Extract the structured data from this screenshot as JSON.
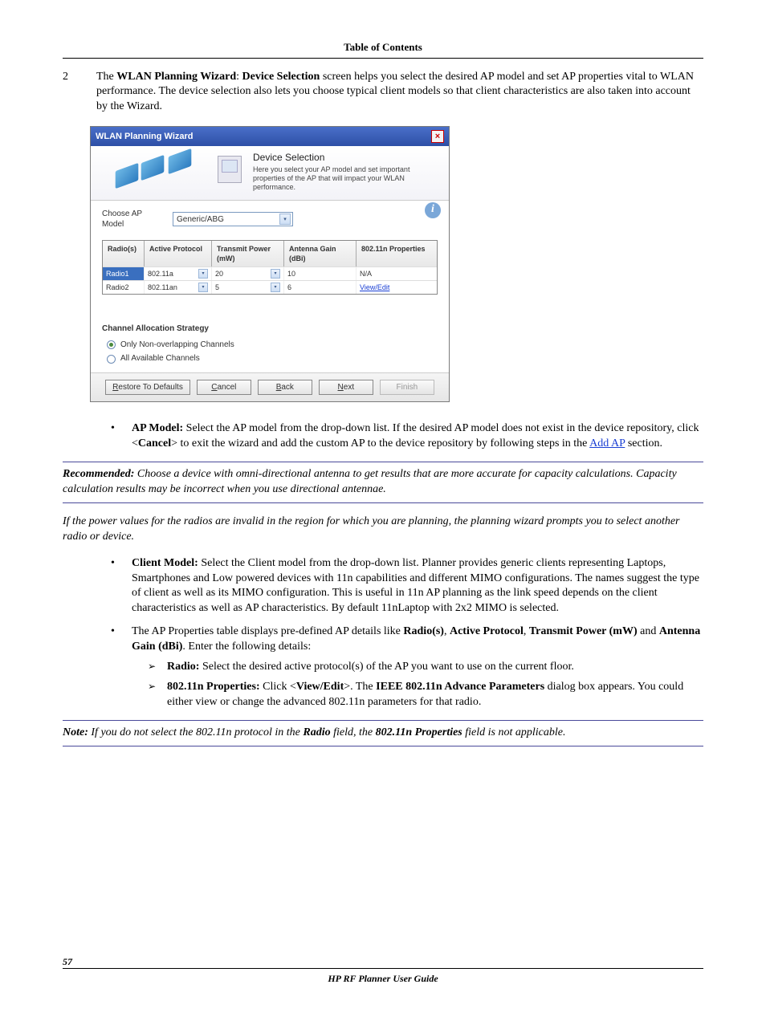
{
  "header": {
    "toc": "Table of Contents"
  },
  "step": {
    "num": "2",
    "text_pre": "The ",
    "b1": "WLAN Planning Wizard",
    "b2": "Device Selection",
    "text_post": " screen helps you select the desired AP model and set AP properties vital to WLAN performance. The device selection also lets you choose typical client models so that client characteristics are also taken into account by the Wizard."
  },
  "wizard": {
    "title": "WLAN Planning Wizard",
    "banner_title": "Device Selection",
    "banner_sub": "Here you select your AP model and set important properties of the AP that will impact your WLAN performance.",
    "ap_label": "Choose AP Model",
    "ap_value": "Generic/ABG",
    "cols": {
      "c1": "Radio(s)",
      "c2": "Active Protocol",
      "c3": "Transmit Power (mW)",
      "c4": "Antenna Gain (dBi)",
      "c5": "802.11n Properties"
    },
    "rows": [
      {
        "radio": "Radio1",
        "proto": "802.11a",
        "power": "20",
        "gain": "10",
        "prop": "N/A",
        "link": false,
        "selected": true
      },
      {
        "radio": "Radio2",
        "proto": "802.11an",
        "power": "5",
        "gain": "6",
        "prop": "View/Edit",
        "link": true,
        "selected": false
      }
    ],
    "strategy_label": "Channel Allocation Strategy",
    "opt1": "Only Non-overlapping Channels",
    "opt2": "All Available Channels",
    "buttons": {
      "restore": "Restore To Defaults",
      "cancel": "Cancel",
      "back": "Back",
      "next": "Next",
      "finish": "Finish"
    }
  },
  "bullets": {
    "ap_b": "AP Model:",
    "ap_t1": " Select the AP model from the drop-down list. If the desired AP model does not exist in the device repository, click <",
    "ap_cancel": "Cancel",
    "ap_t2": "> to exit the wizard and add the custom AP to the device repository by following steps in the ",
    "ap_link": "Add AP",
    "ap_t3": " section.",
    "rec_b": "Recommended:",
    "rec_t": " Choose a device with omni-directional antenna to get results that are more accurate for capacity calculations. Capacity calculation results may be incorrect when you use directional antennae.",
    "pwr": "If the power values for the radios are invalid in the region for which you are planning, the planning wizard prompts you to select another radio or device.",
    "client_b": "Client Model:",
    "client_t": " Select the Client model from the drop-down list. Planner provides generic clients representing Laptops, Smartphones and Low powered devices with 11n capabilities and different MIMO configurations. The names suggest the type of client as well as its MIMO configuration. This is useful in 11n AP planning as the link speed depends on the client characteristics as well as AP characteristics. By default 11nLaptop with 2x2 MIMO is selected.",
    "props_t1": "The AP Properties table displays pre-defined AP details like ",
    "props_b1": "Radio(s)",
    "props_b2": "Active Protocol",
    "props_b3": "Transmit Power (mW)",
    "props_b4": "Antenna Gain (dBi)",
    "props_t2": ". Enter the following details:",
    "sub_radio_b": "Radio:",
    "sub_radio_t": " Select the desired active protocol(s) of the AP you want to use on the current floor.",
    "sub_n_b": "802.11n Properties:",
    "sub_n_t1": " Click <",
    "sub_n_ve": "View/Edit",
    "sub_n_t2": ">. The ",
    "sub_n_dlg": "IEEE 802.11n Advance Parameters",
    "sub_n_t3": " dialog box appears. You could either view or change the advanced 802.11n parameters for that radio.",
    "note_b": "Note:",
    "note_t1": " If you do not select the 802.11n protocol in the ",
    "note_r": "Radio",
    "note_t2": " field, the ",
    "note_p": "802.11n Properties",
    "note_t3": " field is not applicable."
  },
  "footer": {
    "page": "57",
    "guide": "HP RF Planner User Guide"
  }
}
